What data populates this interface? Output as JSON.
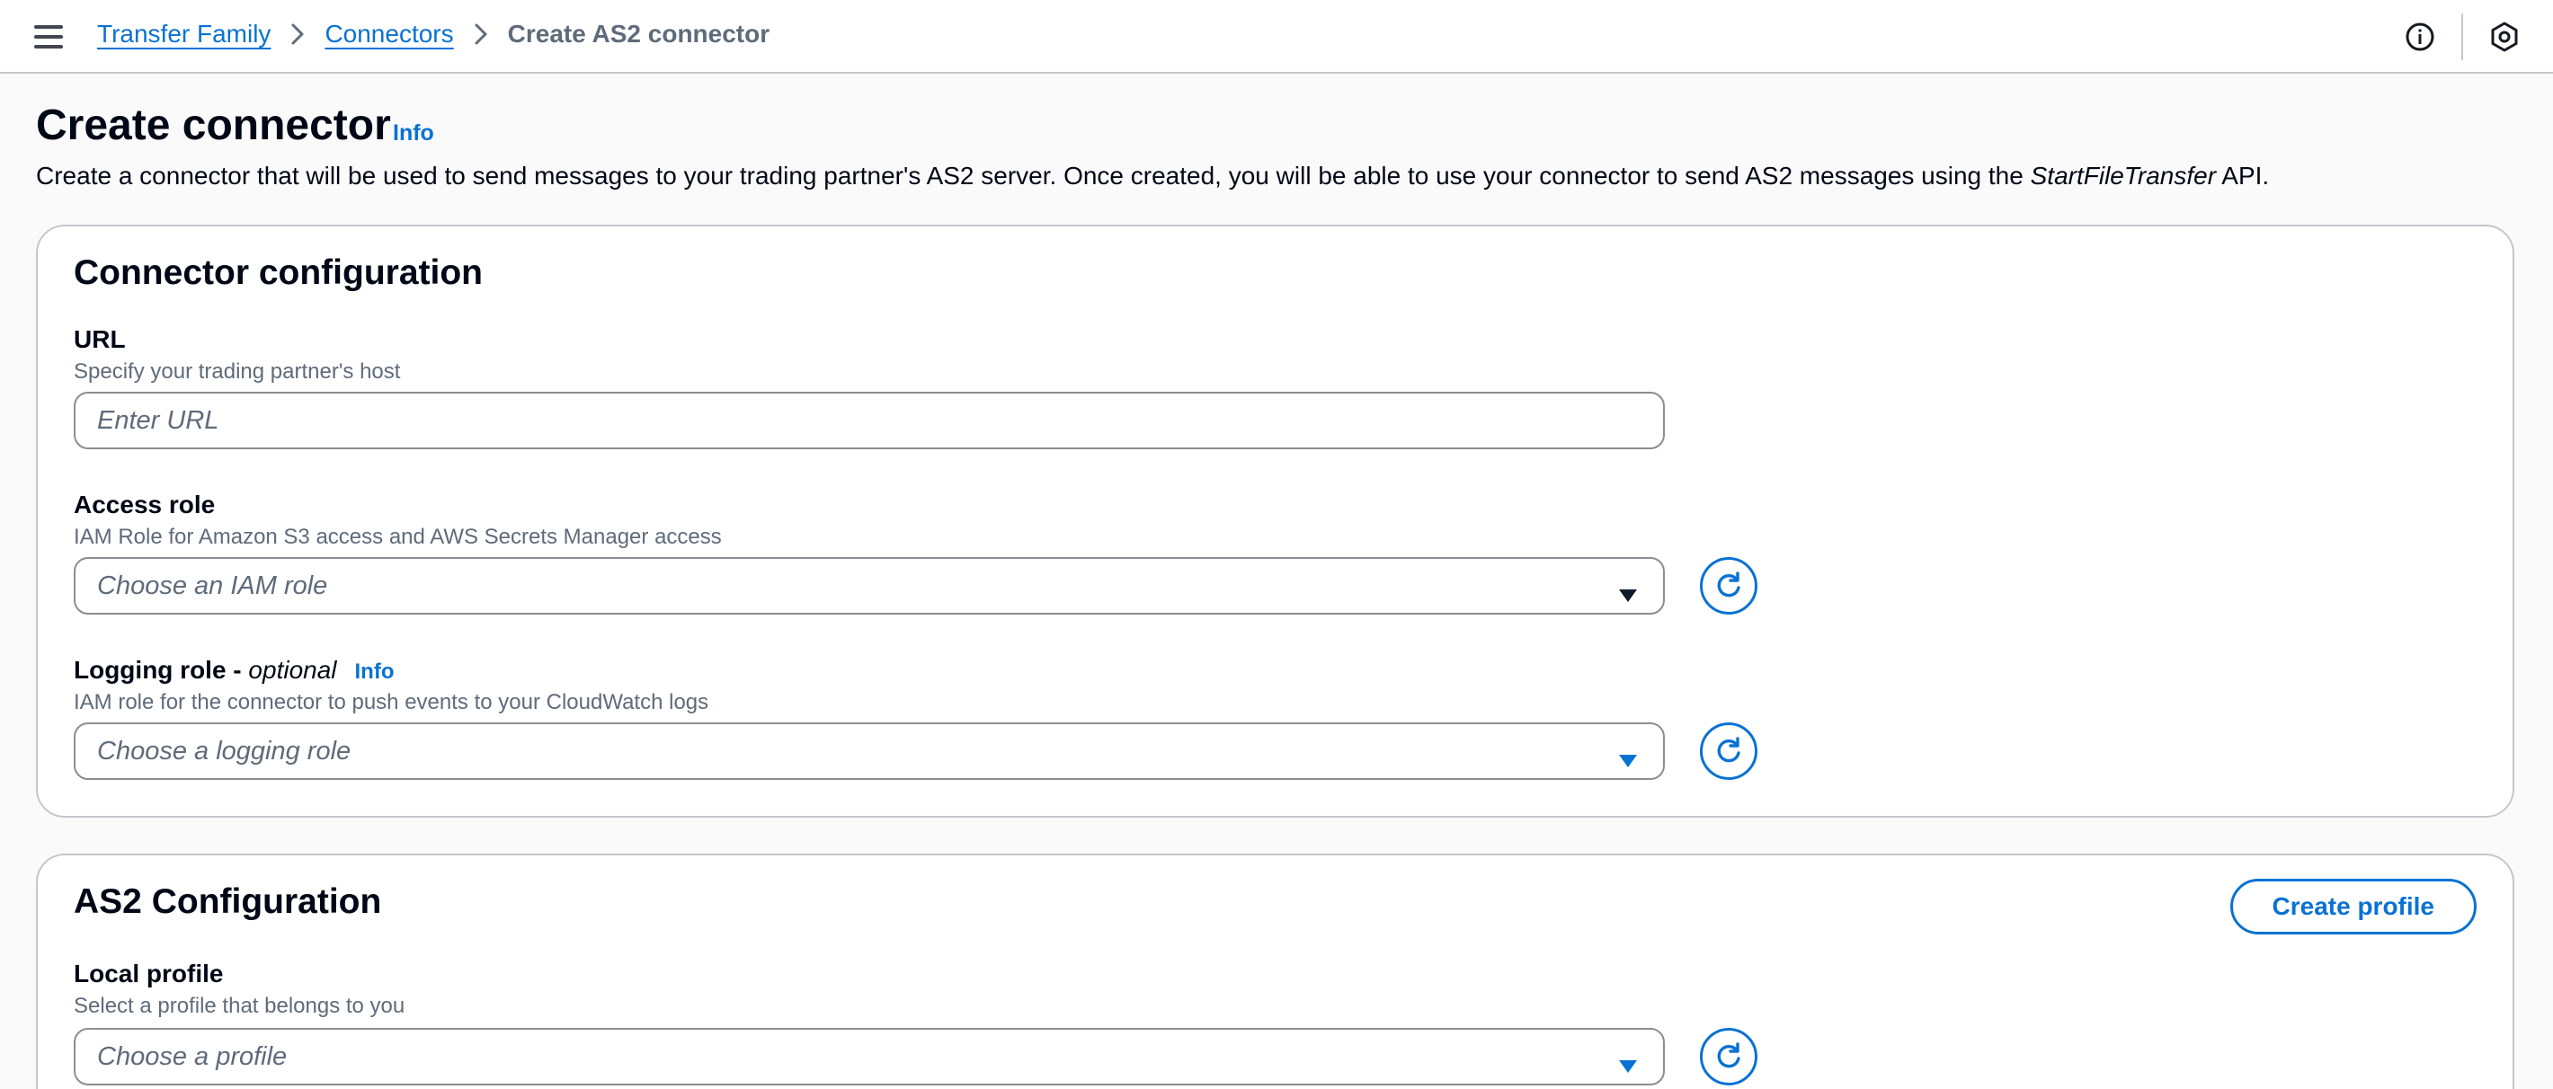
{
  "nav": {
    "breadcrumbs": [
      "Transfer Family",
      "Connectors",
      "Create AS2 connector"
    ]
  },
  "header": {
    "title": "Create connector",
    "info": "Info",
    "description_pre": "Create a connector that will be used to send messages to your trading partner's AS2 server. Once created, you will be able to use your connector to send AS2 messages using the ",
    "description_api": "StartFileTransfer",
    "description_post": " API."
  },
  "connector_config": {
    "title": "Connector configuration",
    "url": {
      "label": "URL",
      "description": "Specify your trading partner's host",
      "placeholder": "Enter URL",
      "value": ""
    },
    "access_role": {
      "label": "Access role",
      "description": "IAM Role for Amazon S3 access and AWS Secrets Manager access",
      "placeholder": "Choose an IAM role"
    },
    "logging_role": {
      "label": "Logging role - ",
      "optional": "optional",
      "info": "Info",
      "description": "IAM role for the connector to push events to your CloudWatch logs",
      "placeholder": "Choose a logging role"
    }
  },
  "as2_config": {
    "title": "AS2 Configuration",
    "create_profile_label": "Create profile",
    "local_profile": {
      "label": "Local profile",
      "description": "Select a profile that belongs to you",
      "placeholder": "Choose a profile"
    }
  },
  "colors": {
    "link": "#0972d3",
    "caret_dark": "#0f1b2a",
    "text": "#000716",
    "muted": "#5f6b7a",
    "border": "#c6c6cd"
  },
  "icons": {
    "menu": "hamburger-menu-icon",
    "breadcrumb_separator": "chevron-right-icon",
    "info": "info-circle-icon",
    "notifications": "hexagon-icon",
    "refresh": "refresh-icon",
    "dropdown": "caret-down-icon"
  }
}
